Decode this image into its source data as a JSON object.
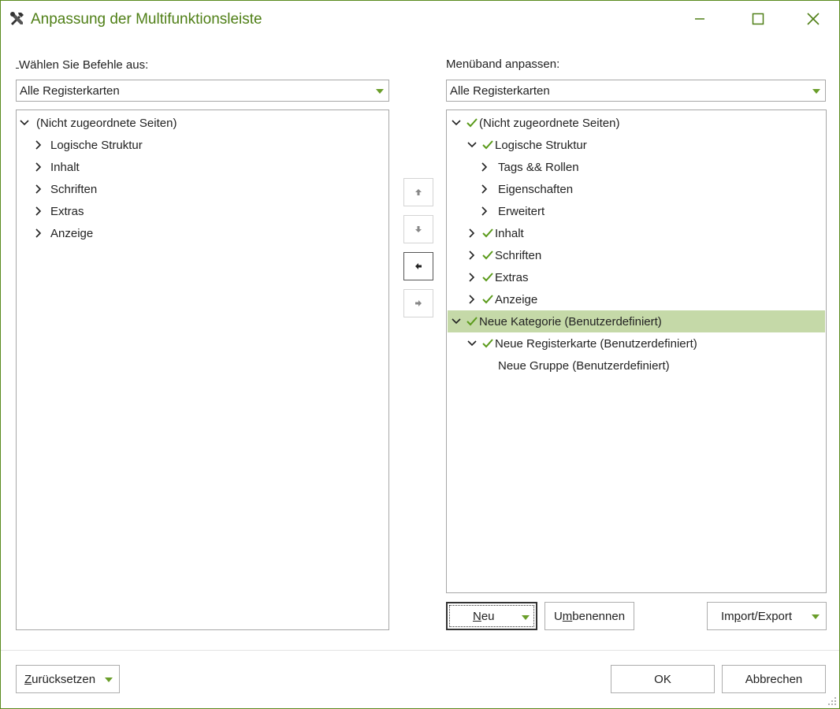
{
  "window": {
    "title": "Anpassung der Multifunktionsleiste",
    "icon": "tools-icon",
    "controls": {
      "minimize": "minimize-icon",
      "maximize": "maximize-icon",
      "close": "close-icon"
    }
  },
  "left": {
    "label_mnemonic": "W",
    "label_rest": "ählen Sie Befehle aus:",
    "combo_value": "Alle Registerkarten",
    "tree": [
      {
        "label": "(Nicht zugeordnete Seiten)",
        "expanded": true
      },
      {
        "label": "Logische Struktur"
      },
      {
        "label": "Inhalt"
      },
      {
        "label": "Schriften"
      },
      {
        "label": "Extras"
      },
      {
        "label": "Anzeige"
      }
    ]
  },
  "right": {
    "label": "Menüband anpassen:",
    "combo_value": "Alle Registerkarten",
    "tree": [
      {
        "label": "(Nicht zugeordnete Seiten)",
        "checked": true,
        "expanded": true
      },
      {
        "label": "Logische Struktur",
        "checked": true,
        "expanded": true
      },
      {
        "label": "Tags && Rollen"
      },
      {
        "label": "Eigenschaften"
      },
      {
        "label": "Erweitert"
      },
      {
        "label": "Inhalt",
        "checked": true
      },
      {
        "label": "Schriften",
        "checked": true
      },
      {
        "label": "Extras",
        "checked": true
      },
      {
        "label": "Anzeige",
        "checked": true
      },
      {
        "label": "Neue Kategorie (Benutzerdefiniert)",
        "checked": true,
        "expanded": true,
        "selected": true
      },
      {
        "label": "Neue Registerkarte (Benutzerdefiniert)",
        "checked": true,
        "expanded": true
      },
      {
        "label": "Neue Gruppe (Benutzerdefiniert)"
      }
    ]
  },
  "move_buttons": {
    "up": "arrow-up-icon",
    "down": "arrow-down-icon",
    "left": "arrow-left-icon",
    "right": "arrow-right-icon"
  },
  "buttons": {
    "new_mn": "N",
    "new_rest": "eu",
    "rename_pre": "U",
    "rename_mn": "m",
    "rename_rest": "benennen",
    "import_pre": "Im",
    "import_mn": "p",
    "import_rest": "ort/Export",
    "reset_pre": "",
    "reset_mn": "Z",
    "reset_rest": "urücksetzen",
    "ok": "OK",
    "cancel": "Abbrechen"
  },
  "colors": {
    "accent": "#4f7f16",
    "check": "#5a9a1a",
    "selection": "#c5d9a8"
  }
}
